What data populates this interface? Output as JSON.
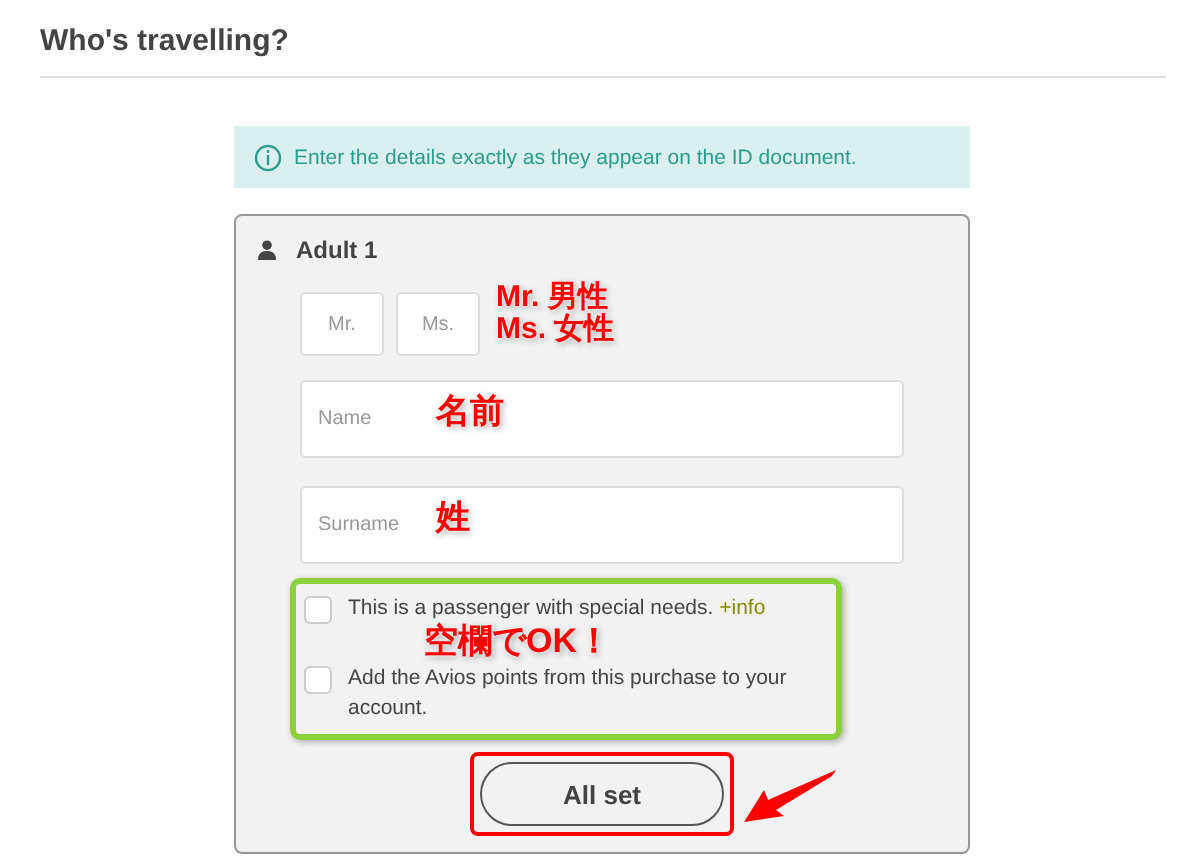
{
  "heading": "Who's travelling?",
  "notice": "Enter the details exactly as they appear on the ID document.",
  "passenger": {
    "label": "Adult 1",
    "titles": [
      {
        "label": "Mr.",
        "selected": false
      },
      {
        "label": "Ms.",
        "selected": false
      }
    ],
    "fields": [
      {
        "placeholder": "Name"
      },
      {
        "placeholder": "Surname"
      }
    ],
    "options": [
      {
        "text": "This is a passenger with special needs.",
        "link": "+info",
        "checked": false
      },
      {
        "text": "Add the Avios points from this purchase to your account.",
        "checked": false
      }
    ],
    "submit": "All set"
  },
  "annotations": {
    "title_note": [
      "Mr. 男性",
      "Ms. 女性"
    ],
    "field_notes": [
      "名前",
      "姓"
    ],
    "options_note": "空欄でOK！"
  }
}
